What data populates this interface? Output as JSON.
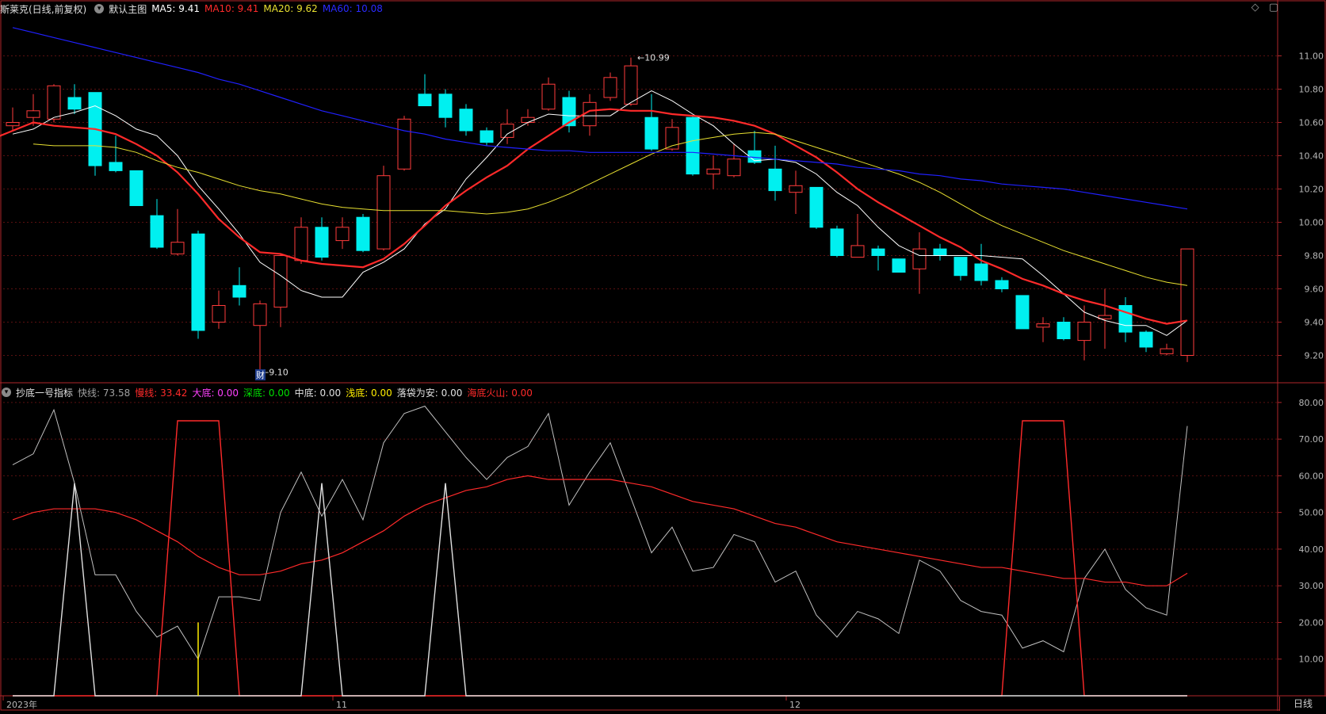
{
  "colors": {
    "up": "#ff3b3b",
    "down": "#00f0f0",
    "ma5": "#ffffff",
    "ma10": "#ff2a2a",
    "ma20": "#e8e030",
    "ma60": "#2020ff",
    "fast": "#c0c0c0",
    "slow": "#ff2a2a",
    "big_bottom": "#ff40ff",
    "deep_bottom": "#00e000",
    "mid_bottom": "#e0e0e0",
    "shallow_bottom": "#ffee00",
    "border": "#b0262a",
    "grid": "#5a1010"
  },
  "header": {
    "title": "斯莱克(日线,前复权)",
    "main_label": "默认主图",
    "ma5": "MA5: 9.41",
    "ma10": "MA10: 9.41",
    "ma20": "MA20: 9.62",
    "ma60": "MA60: 10.08"
  },
  "indicator_header": {
    "title": "抄底一号指标",
    "fast": "快线: 73.58",
    "slow": "慢线: 33.42",
    "big": "大底: 0.00",
    "deep": "深底: 0.00",
    "mid": "中底: 0.00",
    "shallow": "浅底: 0.00",
    "safe": "落袋为安: 0.00",
    "fire": "海底火山: 0.00"
  },
  "toolbar": {
    "diamond_icon": "diamond-icon",
    "window_icon": "window-icon"
  },
  "period_button": "日线",
  "annotations": {
    "high_label": "10.99",
    "low_label": "9.10",
    "finance_badge": "财"
  },
  "chart_data": [
    {
      "type": "candlestick",
      "ylim": [
        9.05,
        11.25
      ],
      "yticks": [
        9.2,
        9.4,
        9.6,
        9.8,
        10.0,
        10.2,
        10.4,
        10.6,
        10.8,
        11.0
      ],
      "ytick_labels": [
        "9.20",
        "9.40",
        "9.60",
        "9.80",
        "10.00",
        "10.20",
        "10.40",
        "10.60",
        "10.80",
        "11.00"
      ],
      "xlabels": [
        {
          "index": 0,
          "label": "2023年"
        },
        {
          "index": 16,
          "label": "11"
        },
        {
          "index": 38,
          "label": "12"
        }
      ],
      "ohlc": [
        [
          10.58,
          10.69,
          10.55,
          10.6
        ],
        [
          10.63,
          10.77,
          10.58,
          10.67
        ],
        [
          10.62,
          10.83,
          10.6,
          10.82
        ],
        [
          10.75,
          10.83,
          10.65,
          10.68
        ],
        [
          10.78,
          10.78,
          10.28,
          10.34
        ],
        [
          10.36,
          10.52,
          10.3,
          10.31
        ],
        [
          10.31,
          10.31,
          10.1,
          10.1
        ],
        [
          10.04,
          10.14,
          9.84,
          9.85
        ],
        [
          9.81,
          10.08,
          9.8,
          9.88
        ],
        [
          9.93,
          9.95,
          9.3,
          9.35
        ],
        [
          9.4,
          9.59,
          9.36,
          9.5
        ],
        [
          9.62,
          9.73,
          9.5,
          9.55
        ],
        [
          9.38,
          9.53,
          9.1,
          9.51
        ],
        [
          9.49,
          9.81,
          9.37,
          9.8
        ],
        [
          9.77,
          10.03,
          9.75,
          9.97
        ],
        [
          9.97,
          10.03,
          9.77,
          9.79
        ],
        [
          9.89,
          10.03,
          9.84,
          9.97
        ],
        [
          10.03,
          10.05,
          9.82,
          9.83
        ],
        [
          9.84,
          10.34,
          9.83,
          10.28
        ],
        [
          10.32,
          10.64,
          10.31,
          10.62
        ],
        [
          10.77,
          10.89,
          10.7,
          10.7
        ],
        [
          10.77,
          10.8,
          10.57,
          10.63
        ],
        [
          10.68,
          10.71,
          10.52,
          10.55
        ],
        [
          10.55,
          10.57,
          10.46,
          10.48
        ],
        [
          10.51,
          10.68,
          10.47,
          10.59
        ],
        [
          10.6,
          10.68,
          10.58,
          10.63
        ],
        [
          10.68,
          10.87,
          10.67,
          10.83
        ],
        [
          10.75,
          10.79,
          10.54,
          10.58
        ],
        [
          10.58,
          10.77,
          10.52,
          10.72
        ],
        [
          10.75,
          10.9,
          10.73,
          10.87
        ],
        [
          10.71,
          10.99,
          10.7,
          10.94
        ],
        [
          10.63,
          10.77,
          10.43,
          10.44
        ],
        [
          10.44,
          10.62,
          10.43,
          10.57
        ],
        [
          10.63,
          10.64,
          10.28,
          10.29
        ],
        [
          10.29,
          10.4,
          10.2,
          10.32
        ],
        [
          10.28,
          10.47,
          10.27,
          10.38
        ],
        [
          10.43,
          10.55,
          10.35,
          10.36
        ],
        [
          10.32,
          10.46,
          10.13,
          10.19
        ],
        [
          10.18,
          10.31,
          10.05,
          10.22
        ],
        [
          10.21,
          10.21,
          9.96,
          9.97
        ],
        [
          9.96,
          9.98,
          9.79,
          9.8
        ],
        [
          9.79,
          10.05,
          9.79,
          9.86
        ],
        [
          9.84,
          9.86,
          9.71,
          9.8
        ],
        [
          9.78,
          9.78,
          9.7,
          9.7
        ],
        [
          9.72,
          9.94,
          9.57,
          9.84
        ],
        [
          9.84,
          9.87,
          9.77,
          9.8
        ],
        [
          9.79,
          9.79,
          9.65,
          9.68
        ],
        [
          9.75,
          9.87,
          9.62,
          9.65
        ],
        [
          9.65,
          9.67,
          9.58,
          9.6
        ],
        [
          9.56,
          9.56,
          9.36,
          9.36
        ],
        [
          9.37,
          9.43,
          9.28,
          9.39
        ],
        [
          9.4,
          9.43,
          9.29,
          9.3
        ],
        [
          9.29,
          9.5,
          9.17,
          9.4
        ],
        [
          9.42,
          9.6,
          9.24,
          9.44
        ],
        [
          9.5,
          9.55,
          9.28,
          9.34
        ],
        [
          9.34,
          9.35,
          9.22,
          9.25
        ],
        [
          9.21,
          9.27,
          9.2,
          9.24
        ],
        [
          9.2,
          9.84,
          9.16,
          9.84
        ]
      ],
      "series": [
        {
          "name": "MA5",
          "values": [
            10.53,
            10.56,
            10.63,
            10.66,
            10.7,
            10.64,
            10.56,
            10.52,
            10.4,
            10.22,
            10.08,
            9.93,
            9.76,
            9.68,
            9.59,
            9.55,
            9.55,
            9.7,
            9.76,
            9.84,
            9.99,
            10.08,
            10.26,
            10.39,
            10.53,
            10.6,
            10.65,
            10.64,
            10.64,
            10.64,
            10.72,
            10.79,
            10.73,
            10.65,
            10.58,
            10.47,
            10.37,
            10.38,
            10.36,
            10.29,
            10.18,
            10.1,
            9.97,
            9.86,
            9.8,
            9.8,
            9.8,
            9.8,
            9.79,
            9.78,
            9.68,
            9.57,
            9.46,
            9.41,
            9.38,
            9.38,
            9.32,
            9.41
          ]
        },
        {
          "name": "MA10",
          "values": [
            10.4,
            10.43,
            10.5,
            10.55,
            10.6,
            10.58,
            10.57,
            10.56,
            10.53,
            10.47,
            10.4,
            10.3,
            10.17,
            10.02,
            9.91,
            9.82,
            9.81,
            9.77,
            9.75,
            9.74,
            9.73,
            9.78,
            9.87,
            9.98,
            10.1,
            10.19,
            10.27,
            10.34,
            10.44,
            10.52,
            10.6,
            10.67,
            10.68,
            10.67,
            10.67,
            10.65,
            10.64,
            10.63,
            10.61,
            10.58,
            10.53,
            10.46,
            10.39,
            10.3,
            10.2,
            10.12,
            10.05,
            9.98,
            9.91,
            9.85,
            9.77,
            9.72,
            9.66,
            9.62,
            9.57,
            9.53,
            9.5,
            9.46,
            9.42,
            9.39,
            9.41
          ]
        },
        {
          "name": "MA20",
          "values": [
            10.47,
            10.46,
            10.46,
            10.46,
            10.45,
            10.42,
            10.37,
            10.33,
            10.3,
            10.26,
            10.22,
            10.19,
            10.17,
            10.14,
            10.11,
            10.09,
            10.08,
            10.07,
            10.07,
            10.07,
            10.07,
            10.06,
            10.05,
            10.06,
            10.08,
            10.12,
            10.17,
            10.23,
            10.29,
            10.35,
            10.41,
            10.46,
            10.49,
            10.51,
            10.53,
            10.54,
            10.53,
            10.49,
            10.45,
            10.41,
            10.37,
            10.33,
            10.29,
            10.24,
            10.18,
            10.11,
            10.04,
            9.98,
            9.93,
            9.88,
            9.83,
            9.79,
            9.75,
            9.71,
            9.67,
            9.64,
            9.62
          ]
        },
        {
          "name": "MA60",
          "values": [
            11.17,
            11.14,
            11.11,
            11.08,
            11.05,
            11.02,
            10.99,
            10.96,
            10.93,
            10.9,
            10.86,
            10.83,
            10.79,
            10.75,
            10.71,
            10.67,
            10.64,
            10.61,
            10.58,
            10.55,
            10.53,
            10.5,
            10.48,
            10.46,
            10.45,
            10.44,
            10.43,
            10.43,
            10.42,
            10.42,
            10.42,
            10.42,
            10.42,
            10.42,
            10.41,
            10.4,
            10.39,
            10.38,
            10.37,
            10.36,
            10.35,
            10.33,
            10.32,
            10.31,
            10.29,
            10.28,
            10.26,
            10.25,
            10.23,
            10.22,
            10.21,
            10.2,
            10.18,
            10.16,
            10.14,
            10.12,
            10.1,
            10.08
          ]
        }
      ]
    },
    {
      "type": "line",
      "ylim": [
        0,
        83
      ],
      "yticks": [
        10,
        20,
        30,
        40,
        50,
        60,
        70,
        80
      ],
      "ytick_labels": [
        "10.00",
        "20.00",
        "30.00",
        "40.00",
        "50.00",
        "60.00",
        "70.00",
        "80.00"
      ],
      "series": [
        {
          "name": "快线",
          "values": [
            63,
            66,
            78,
            58,
            33,
            33,
            23,
            16,
            19,
            10,
            27,
            27,
            26,
            50,
            61,
            49,
            59,
            48,
            69,
            77,
            79,
            72,
            65,
            59,
            65,
            68,
            77,
            52,
            61,
            69,
            54,
            39,
            46,
            34,
            35,
            44,
            42,
            31,
            34,
            22,
            16,
            23,
            21,
            17,
            37,
            34,
            26,
            23,
            22,
            13,
            15,
            12,
            32,
            40,
            29,
            24,
            22,
            73.58
          ]
        },
        {
          "name": "慢线",
          "values": [
            48,
            50,
            51,
            51,
            51,
            50,
            48,
            45,
            42,
            38,
            35,
            33,
            33,
            34,
            36,
            37,
            39,
            42,
            45,
            49,
            52,
            54,
            56,
            57,
            59,
            60,
            59,
            59,
            59,
            59,
            58,
            57,
            55,
            53,
            52,
            51,
            49,
            47,
            46,
            44,
            42,
            41,
            40,
            39,
            38,
            37,
            36,
            35,
            35,
            34,
            33,
            32,
            32,
            31,
            31,
            30,
            30,
            33.42
          ]
        },
        {
          "name": "大底",
          "values": [
            0,
            0,
            0,
            0,
            0,
            0,
            0,
            0,
            75,
            75,
            75,
            0,
            0,
            0,
            0,
            0,
            0,
            0,
            0,
            0,
            0,
            0,
            0,
            0,
            0,
            0,
            0,
            0,
            0,
            0,
            0,
            0,
            0,
            0,
            0,
            0,
            0,
            0,
            0,
            0,
            0,
            0,
            0,
            0,
            0,
            0,
            0,
            0,
            0,
            75,
            75,
            75,
            0,
            0,
            0,
            0,
            0,
            0
          ]
        },
        {
          "name": "中底",
          "values": [
            0,
            0,
            0,
            58,
            0,
            0,
            0,
            0,
            0,
            0,
            0,
            0,
            0,
            0,
            0,
            58,
            0,
            0,
            0,
            0,
            0,
            58,
            0,
            0,
            0,
            0,
            0,
            0,
            0,
            0,
            0,
            0,
            0,
            0,
            0,
            0,
            0,
            0,
            0,
            0,
            0,
            0,
            0,
            0,
            0,
            0,
            0,
            0,
            0,
            0,
            0,
            0,
            0,
            0,
            0,
            0,
            0,
            0
          ]
        },
        {
          "name": "浅底",
          "values": [
            0,
            0,
            0,
            0,
            0,
            0,
            0,
            0,
            0,
            20,
            0,
            0,
            0,
            0,
            0,
            0,
            0,
            0,
            0,
            0,
            0,
            0,
            0,
            0,
            0,
            0,
            0,
            0,
            0,
            0,
            0,
            0,
            0,
            0,
            0,
            0,
            0,
            0,
            0,
            0,
            0,
            0,
            0,
            0,
            0,
            0,
            0,
            0,
            0,
            0,
            0,
            0,
            0,
            0,
            0,
            0,
            0,
            0
          ]
        }
      ]
    }
  ]
}
